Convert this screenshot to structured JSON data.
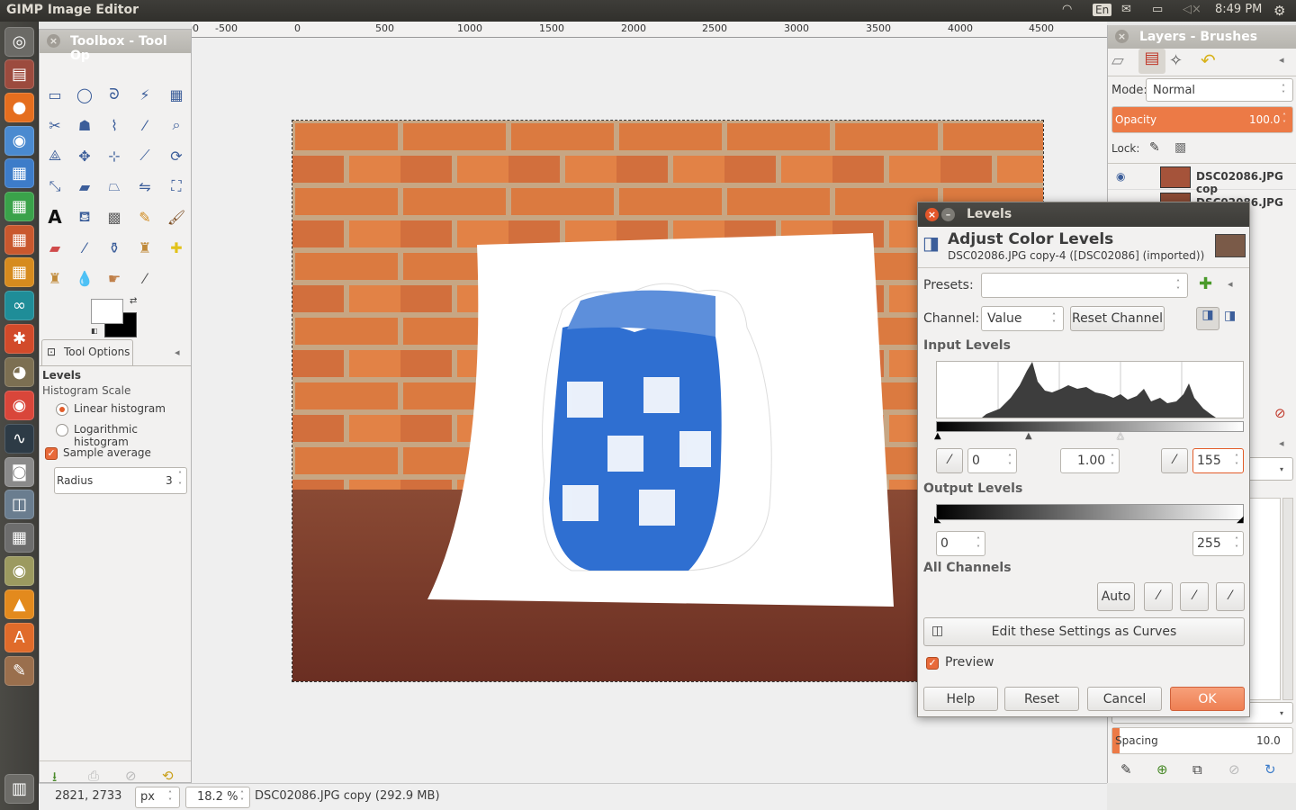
{
  "topbar": {
    "title": "GIMP Image Editor",
    "keyboard": "En",
    "clock": "8:49 PM"
  },
  "launcher": {
    "icons": [
      "dash-icon",
      "files-icon",
      "firefox-icon",
      "chromium-icon",
      "writer-icon",
      "calc-icon",
      "impress-icon",
      "draw-icon",
      "arduino-icon",
      "settings-icon",
      "gimp-icon",
      "chrome-icon",
      "system-monitor-icon",
      "camera-icon",
      "screenshot-icon",
      "calculator-icon",
      "media-icon",
      "vlc-icon",
      "software-center-icon",
      "tools-icon",
      "trash-icon"
    ]
  },
  "ruler": {
    "labels": [
      "1000",
      "500",
      "0",
      "500",
      "1000",
      "1500",
      "2000",
      "2500",
      "3000",
      "3500",
      "4000",
      "4500"
    ]
  },
  "toolbox": {
    "title": "Toolbox - Tool Op",
    "tab_label": "Tool Options",
    "section": "Levels",
    "histogram_scale_label": "Histogram Scale",
    "linear_label": "Linear histogram",
    "log_label": "Logarithmic histogram",
    "sample_average_label": "Sample average",
    "radius_label": "Radius",
    "radius_value": "3"
  },
  "status": {
    "coords": "2821, 2733",
    "unit": "px",
    "zoom": "18.2 %",
    "message": "DSC02086.JPG copy (292.9 MB)"
  },
  "layers": {
    "title": "Layers - Brushes",
    "mode_label": "Mode:",
    "mode_value": "Normal",
    "opacity_label": "Opacity",
    "opacity_value": "100.0",
    "lock_label": "Lock:",
    "layer1": "DSC02086.JPG cop",
    "layer2": "DSC02086.JPG",
    "spacing_label": "Spacing",
    "spacing_value": "10.0"
  },
  "levels": {
    "window_title": "Levels",
    "heading": "Adjust Color Levels",
    "subheading": "DSC02086.JPG copy-4 ([DSC02086] (imported))",
    "presets_label": "Presets:",
    "channel_label": "Channel:",
    "channel_value": "Value",
    "reset_channel": "Reset Channel",
    "input_levels": "Input Levels",
    "input_low": "0",
    "input_gamma": "1.00",
    "input_high": "155",
    "output_levels": "Output Levels",
    "output_low": "0",
    "output_high": "255",
    "all_channels": "All Channels",
    "auto": "Auto",
    "edit_curves": "Edit these Settings as Curves",
    "preview": "Preview",
    "help": "Help",
    "reset": "Reset",
    "cancel": "Cancel",
    "ok": "OK"
  },
  "colors": {
    "accent": "#e86a3a",
    "panel": "#f2f1f0",
    "titlebar": "#3c3b37"
  }
}
